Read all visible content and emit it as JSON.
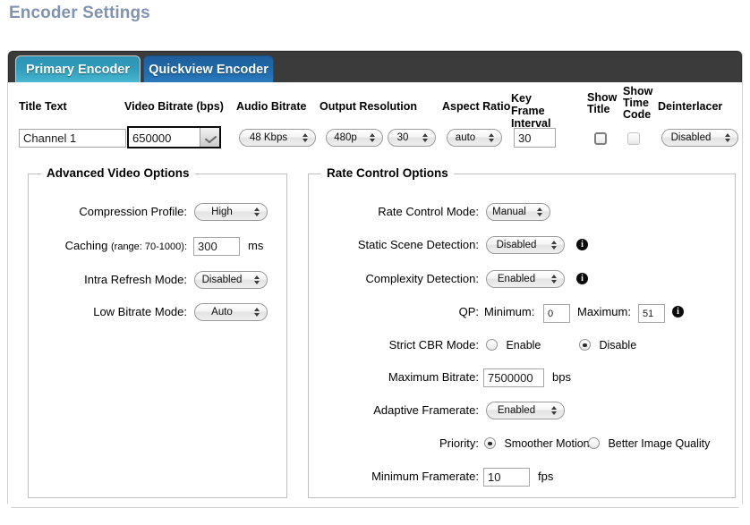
{
  "page": {
    "title": "Encoder Settings",
    "title_color": "#8093b0"
  },
  "tabs": [
    {
      "id": "primary",
      "label": "Primary Encoder",
      "active": true,
      "color": "#2f9dbd"
    },
    {
      "id": "quickview",
      "label": "Quickview Encoder",
      "active": false,
      "color": "#1e6aab"
    }
  ],
  "top_row": {
    "title_text": {
      "label": "Title Text",
      "value": "Channel 1"
    },
    "video_bitrate": {
      "label": "Video Bitrate (bps)",
      "value": "650000"
    },
    "audio_bitrate": {
      "label": "Audio Bitrate",
      "value": "48 Kbps"
    },
    "output_resolution": {
      "label": "Output Resolution",
      "resolution_value": "480p",
      "framerate_value": "30"
    },
    "aspect_ratio": {
      "label": "Aspect Ratio",
      "value": "auto"
    },
    "key_frame_interval": {
      "label": "Key Frame Interval",
      "value": "30"
    },
    "show_title": {
      "label": "Show Title",
      "checked": false
    },
    "show_time_code": {
      "label": "Show Time Code",
      "checked": false
    },
    "deinterlacer": {
      "label": "Deinterlacer",
      "value": "Disabled"
    }
  },
  "advanced_video_options": {
    "legend": "Advanced Video Options",
    "compression_profile": {
      "label": "Compression Profile:",
      "value": "High"
    },
    "caching": {
      "label": "Caching",
      "label_sub": "(range: 70-1000):",
      "value": "300",
      "unit": "ms"
    },
    "intra_refresh_mode": {
      "label": "Intra Refresh Mode:",
      "value": "Disabled"
    },
    "low_bitrate_mode": {
      "label": "Low Bitrate Mode:",
      "value": "Auto"
    }
  },
  "rate_control_options": {
    "legend": "Rate Control Options",
    "rate_control_mode": {
      "label": "Rate Control Mode:",
      "value": "Manual"
    },
    "static_scene_detection": {
      "label": "Static Scene Detection:",
      "value": "Disabled",
      "info": "i"
    },
    "complexity_detection": {
      "label": "Complexity Detection:",
      "value": "Enabled",
      "info": "i"
    },
    "qp": {
      "label": "QP:",
      "minimum_label": "Minimum:",
      "minimum_value": "0",
      "maximum_label": "Maximum:",
      "maximum_value": "51",
      "info": "i"
    },
    "strict_cbr_mode": {
      "label": "Strict CBR Mode:",
      "options": [
        {
          "label": "Enable",
          "selected": false
        },
        {
          "label": "Disable",
          "selected": true
        }
      ]
    },
    "maximum_bitrate": {
      "label": "Maximum Bitrate:",
      "value": "7500000",
      "unit": "bps"
    },
    "adaptive_framerate": {
      "label": "Adaptive Framerate:",
      "value": "Enabled"
    },
    "priority": {
      "label": "Priority:",
      "options": [
        {
          "label": "Smoother Motion",
          "selected": true
        },
        {
          "label": "Better Image Quality",
          "selected": false
        }
      ]
    },
    "minimum_framerate": {
      "label": "Minimum Framerate:",
      "value": "10",
      "unit": "fps"
    }
  }
}
